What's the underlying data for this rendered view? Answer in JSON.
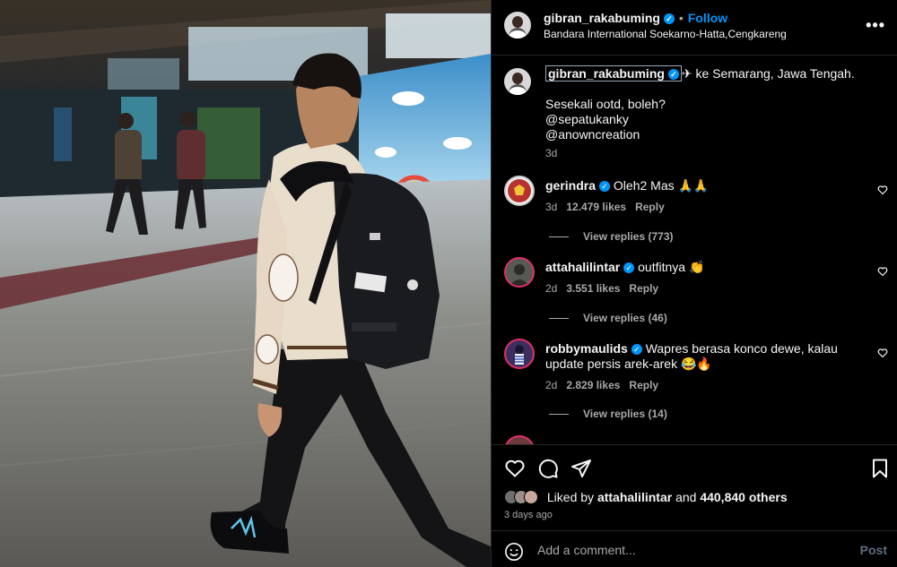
{
  "post": {
    "username": "gibran_rakabuming",
    "follow_label": "Follow",
    "location": "Bandara International Soekarno-Hatta,Cengkareng",
    "more_label": "•••"
  },
  "caption": {
    "username": "gibran_rakabuming",
    "text_first": "✈ ke Semarang, Jawa Tengah.",
    "line2": "Sesekali ootd, boleh?",
    "line3": "@sepatukanky",
    "line4": "@anowncreation",
    "time": "3d"
  },
  "comments": [
    {
      "username": "gerindra",
      "text": "Oleh2 Mas 🙏🙏",
      "time": "3d",
      "likes": "12.479 likes",
      "reply_label": "Reply",
      "view_replies": "View replies (773)",
      "avatar_color": "#b8322f"
    },
    {
      "username": "attahalilintar",
      "text": "outfitnya 👏",
      "time": "2d",
      "likes": "3.551 likes",
      "reply_label": "Reply",
      "view_replies": "View replies (46)",
      "avatar_color": "#555b52"
    },
    {
      "username": "robbymaulids",
      "text": "Wapres berasa konco dewe, kalau update persis arek-arek 😂🔥",
      "time": "2d",
      "likes": "2.829 likes",
      "reply_label": "Reply",
      "view_replies": "View replies (14)",
      "avatar_color": "#3c2f5e"
    }
  ],
  "actions": {
    "liked_prefix": "Liked by",
    "liked_user": "attahalilintar",
    "liked_and": "and",
    "liked_count": "440,840 others",
    "time_ago": "3 days ago"
  },
  "composer": {
    "placeholder": "Add a comment...",
    "post_label": "Post"
  },
  "colors": {
    "accent": "#0095f6",
    "background": "#000000",
    "story_ring": "#e1306c"
  }
}
